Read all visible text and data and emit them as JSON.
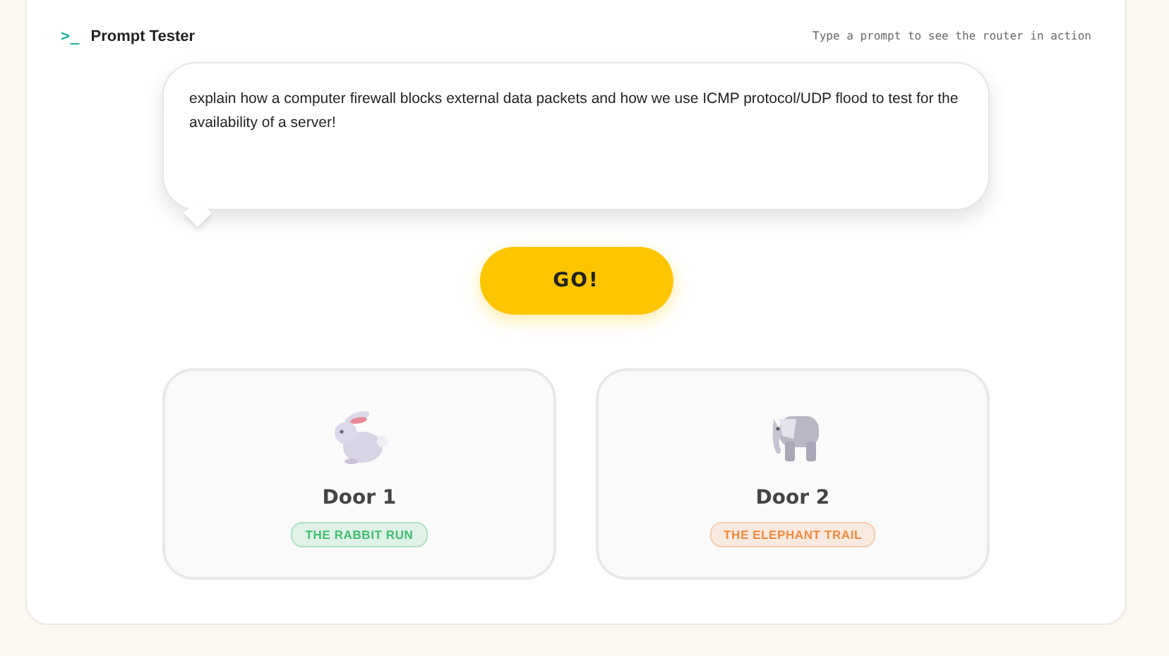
{
  "header": {
    "icon": ">_",
    "title": "Prompt Tester",
    "hint": "Type a prompt to see the router in action"
  },
  "prompt": {
    "value": "explain how a computer firewall blocks external data packets and how we use ICMP protocol/UDP flood to test for the availability of a server!"
  },
  "go_button": "GO!",
  "doors": [
    {
      "kind": "rabbit",
      "title": "Door 1",
      "tag": "THE RABBIT RUN",
      "color": "#3cbf6e"
    },
    {
      "kind": "elephant",
      "title": "Door 2",
      "tag": "THE ELEPHANT TRAIL",
      "color": "#f08a3c"
    }
  ]
}
